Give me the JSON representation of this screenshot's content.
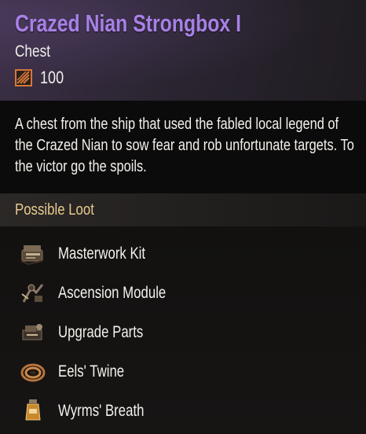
{
  "item": {
    "name": "Crazed Nian Strongbox I",
    "type": "Chest",
    "gear_score": "100",
    "description": "A chest from the ship that used the fabled local legend of the Crazed Nian to sow fear and rob unfortunate targets. To the victor go the spoils."
  },
  "loot": {
    "title": "Possible Loot",
    "items": [
      {
        "label": "Masterwork Kit",
        "icon": "masterwork-kit-icon"
      },
      {
        "label": "Ascension Module",
        "icon": "ascension-module-icon"
      },
      {
        "label": "Upgrade Parts",
        "icon": "upgrade-parts-icon"
      },
      {
        "label": "Eels' Twine",
        "icon": "rope-coil-icon"
      },
      {
        "label": "Wyrms' Breath",
        "icon": "potion-jar-icon"
      }
    ]
  },
  "colors": {
    "title": "#a780e6",
    "loot_title": "#e7c98f",
    "stat_icon": "#d6773a"
  }
}
